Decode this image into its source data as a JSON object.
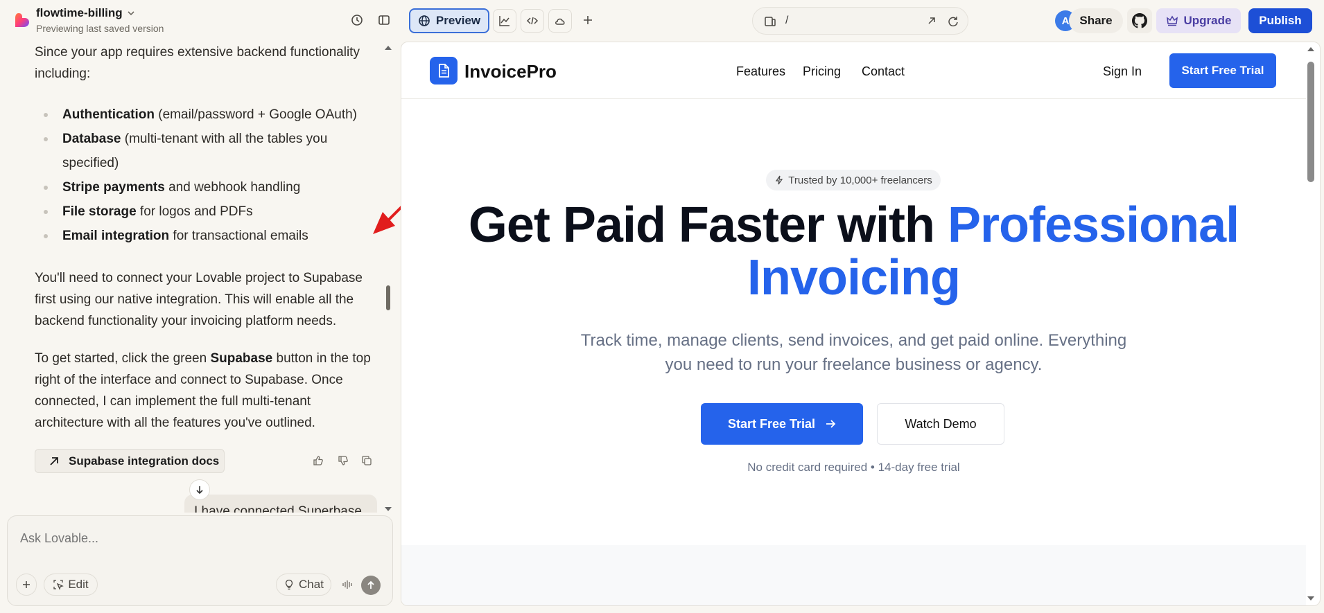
{
  "colors": {
    "accent": "#2563eb",
    "publish": "#1d4fd6",
    "upgrade_bg": "#e7e2f6",
    "avatar": "#3c7be8",
    "annotation_arrow": "#e11d1d"
  },
  "topbar": {
    "project_name": "flowtime-billing",
    "project_status": "Previewing last saved version",
    "preview_label": "Preview",
    "url_path": "/",
    "avatar_initial": "A",
    "share_label": "Share",
    "upgrade_label": "Upgrade",
    "publish_label": "Publish"
  },
  "chat": {
    "intro": "Since your app requires extensive backend functionality including:",
    "bullets": [
      {
        "bold": "Authentication",
        "rest": " (email/password + Google OAuth)"
      },
      {
        "bold": "Database",
        "rest": " (multi-tenant with all the tables you specified)"
      },
      {
        "bold": "Stripe payments",
        "rest": " and webhook handling"
      },
      {
        "bold": "File storage",
        "rest": " for logos and PDFs"
      },
      {
        "bold": "Email integration",
        "rest": " for transactional emails"
      }
    ],
    "para2": "You'll need to connect your Lovable project to Supabase first using our native integration. This will enable all the backend functionality your invoicing platform needs.",
    "para3_pre": "To get started, click the green ",
    "para3_bold": "Supabase",
    "para3_post": " button in the top right of the interface and connect to Supabase. Once connected, I can implement the full multi-tenant architecture with all the features you've outlined.",
    "docs_link": "Supabase integration docs",
    "user_message": "I have connected Superbase"
  },
  "composer": {
    "placeholder": "Ask Lovable...",
    "edit_label": "Edit",
    "chat_label": "Chat"
  },
  "site": {
    "brand": "InvoicePro",
    "nav": [
      "Features",
      "Pricing",
      "Contact"
    ],
    "sign_in": "Sign In",
    "nav_cta": "Start Free Trial",
    "badge": "Trusted by 10,000+ freelancers",
    "hero_title_dark": "Get Paid Faster with ",
    "hero_title_blue_1": "Professional",
    "hero_title_blue_2": "Invoicing",
    "hero_sub": "Track time, manage clients, send invoices, and get paid online. Everything you need to run your freelance business or agency.",
    "cta_primary": "Start Free Trial",
    "cta_secondary": "Watch Demo",
    "cta_note": "No credit card required • 14-day free trial"
  }
}
